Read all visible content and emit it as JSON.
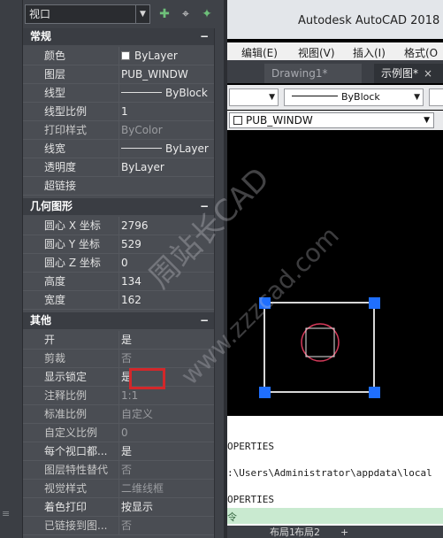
{
  "palette": {
    "object_select": "视口",
    "collapse_symbol": "−",
    "sections": [
      {
        "title": "常规",
        "rows": [
          {
            "key": "颜色",
            "value": "ByLayer",
            "swatch": true
          },
          {
            "key": "图层",
            "value": "PUB_WINDW"
          },
          {
            "key": "线型",
            "value": "ByBlock",
            "line": true
          },
          {
            "key": "线型比例",
            "value": "1"
          },
          {
            "key": "打印样式",
            "value": "ByColor",
            "dim": true
          },
          {
            "key": "线宽",
            "value": "ByLayer",
            "line": true
          },
          {
            "key": "透明度",
            "value": "ByLayer"
          },
          {
            "key": "超链接",
            "value": ""
          }
        ]
      },
      {
        "title": "几何图形",
        "rows": [
          {
            "key": "圆心 X 坐标",
            "value": "2796"
          },
          {
            "key": "圆心 Y 坐标",
            "value": "529"
          },
          {
            "key": "圆心 Z 坐标",
            "value": "0"
          },
          {
            "key": "高度",
            "value": "134"
          },
          {
            "key": "宽度",
            "value": "162"
          }
        ]
      },
      {
        "title": "其他",
        "rows": [
          {
            "key": "开",
            "value": "是"
          },
          {
            "key": "剪裁",
            "value": "否",
            "dim": true
          },
          {
            "key": "显示锁定",
            "value": "是",
            "highlight": true
          },
          {
            "key": "注释比例",
            "value": "1:1",
            "dim": true
          },
          {
            "key": "标准比例",
            "value": "自定义",
            "dim": true
          },
          {
            "key": "自定义比例",
            "value": "0",
            "dim": true
          },
          {
            "key": "每个视口都...",
            "value": "是"
          },
          {
            "key": "图层特性替代",
            "value": "否",
            "dim": true
          },
          {
            "key": "视觉样式",
            "value": "二维线框",
            "dim": true
          },
          {
            "key": "着色打印",
            "value": "按显示"
          },
          {
            "key": "已链接到图...",
            "value": "否",
            "dim": true
          }
        ]
      }
    ]
  },
  "strip": {
    "mark": "≡"
  },
  "acad": {
    "title": "Autodesk AutoCAD 2018",
    "menus": [
      "编辑(E)",
      "视图(V)",
      "插入(I)",
      "格式(O"
    ],
    "tabs": [
      {
        "label": "Drawing1*",
        "active": false
      },
      {
        "label": "示例图*",
        "active": true
      }
    ],
    "tab_close": "×",
    "linetype_dd": "ByBlock",
    "layer_dd": "PUB_WINDW",
    "command_lines": [
      "OPERTIES",
      ":\\Users\\Administrator\\appdata\\local",
      "OPERTIES"
    ],
    "command_prompt": "令",
    "layout_tabs": [
      "布局1",
      "布局2"
    ],
    "add_layout": "+"
  },
  "watermark": {
    "line1": "周站长CAD",
    "line2": "www.zzzcad.com"
  },
  "colors": {
    "viewport_frame": "#d7d7d7",
    "grip": "#1f6fff",
    "circle": "#d53a5a",
    "highlight": "#d3272a"
  }
}
